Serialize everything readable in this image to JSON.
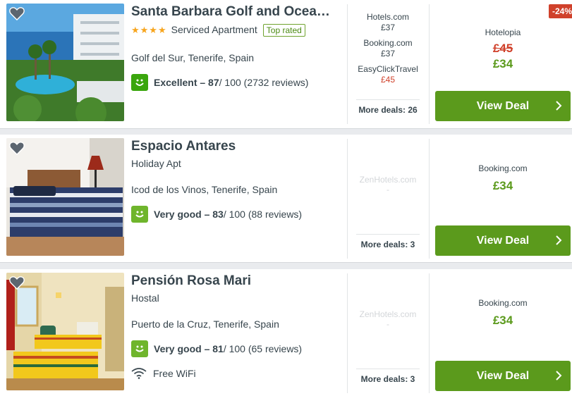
{
  "hotels": [
    {
      "name": "Santa Barbara Golf and Ocea…",
      "stars": "★★★★",
      "type": "Serviced Apartment",
      "badge": "Top rated",
      "location": "Golf del Sur, Tenerife, Spain",
      "rating_label": "Excellent – 87",
      "rating_rest": " / 100 (2732 reviews)",
      "deals": [
        {
          "provider": "Hotels.com",
          "price": "£37"
        },
        {
          "provider": "Booking.com",
          "price": "£37"
        },
        {
          "provider": "EasyClickTravel",
          "price": "£45"
        }
      ],
      "more_deals": "More deals: 26",
      "best_provider": "Hotelopia",
      "best_old_price": "£45",
      "best_price": "£34",
      "discount": "-24%",
      "button": "View Deal"
    },
    {
      "name": "Espacio Antares",
      "type": "Holiday Apt",
      "location": "Icod de los Vinos, Tenerife, Spain",
      "rating_label": "Very good – 83",
      "rating_rest": " / 100 (88 reviews)",
      "ghost_provider": "ZenHotels.com",
      "ghost_price": "-",
      "more_deals": "More deals: 3",
      "best_provider": "Booking.com",
      "best_price": "£34",
      "button": "View Deal"
    },
    {
      "name": "Pensión Rosa Mari",
      "type": "Hostal",
      "location": "Puerto de la Cruz, Tenerife, Spain",
      "rating_label": "Very good – 81",
      "rating_rest": " / 100 (65 reviews)",
      "amenity": "Free WiFi",
      "ghost_provider": "ZenHotels.com",
      "ghost_price": "-",
      "more_deals": "More deals: 3",
      "best_provider": "Booking.com",
      "best_price": "£34",
      "button": "View Deal"
    }
  ],
  "colors": {
    "green": "#5b9a1c",
    "red": "#d0412b",
    "text": "#37454d",
    "rating_excellent": "#3aa60d",
    "rating_verygood": "#6fb52c"
  },
  "icons": [
    "heart-icon",
    "star-icon",
    "smiley-icon",
    "wifi-icon",
    "chevron-right-icon"
  ]
}
